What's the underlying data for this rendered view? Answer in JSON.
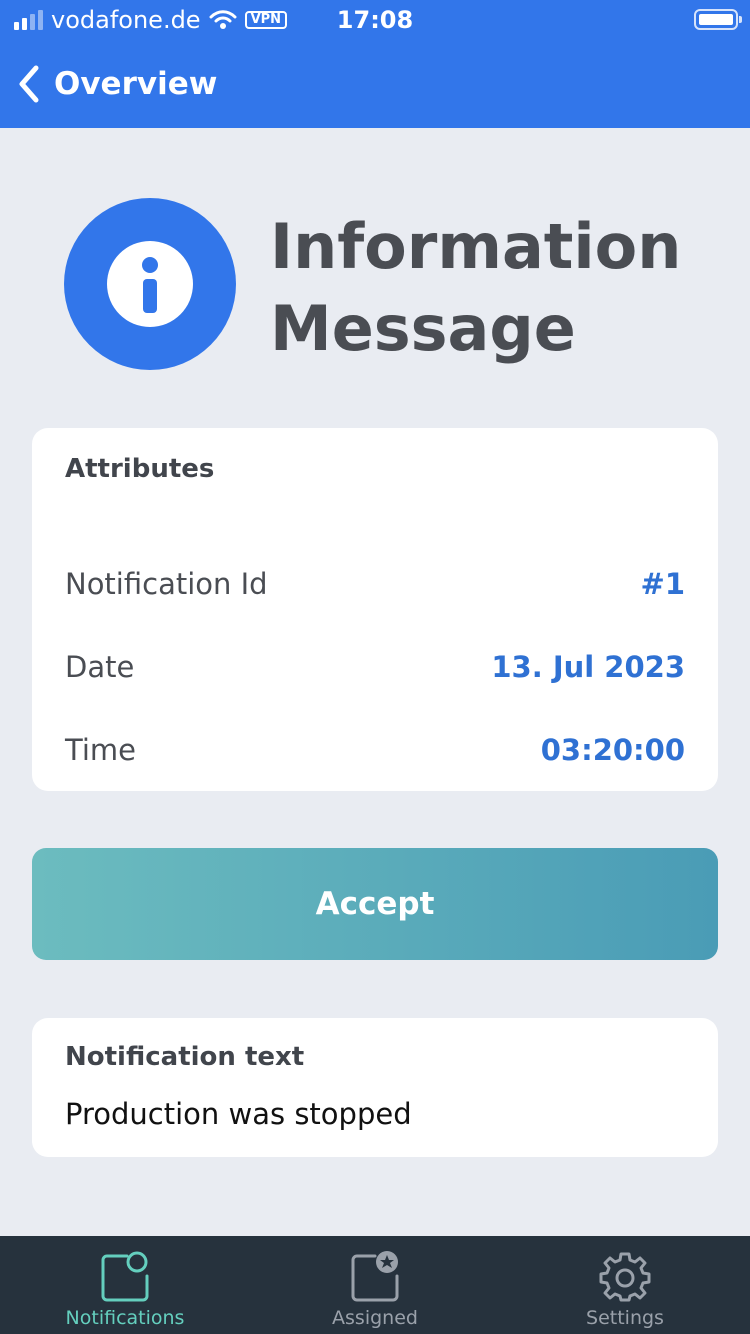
{
  "status_bar": {
    "carrier": "vodafone.de",
    "vpn_label": "VPN",
    "time": "17:08"
  },
  "nav": {
    "back_label": "Overview"
  },
  "hero": {
    "title_line1": "Information",
    "title_line2": "Message",
    "icon": "info-icon"
  },
  "attributes": {
    "title": "Attributes",
    "rows": [
      {
        "label": "Notification Id",
        "value": "#1"
      },
      {
        "label": "Date",
        "value": "13. Jul 2023"
      },
      {
        "label": "Time",
        "value": "03:20:00"
      }
    ]
  },
  "accept_label": "Accept",
  "notification": {
    "title": "Notification text",
    "text": "Production was stopped"
  },
  "tabs": [
    {
      "label": "Notifications",
      "icon": "notifications-icon",
      "active": true
    },
    {
      "label": "Assigned",
      "icon": "assigned-icon",
      "active": false
    },
    {
      "label": "Settings",
      "icon": "gear-icon",
      "active": false
    }
  ],
  "colors": {
    "header": "#3276ea",
    "accent_value": "#2f71d3",
    "accept_start": "#6cbcbf",
    "accept_end": "#4a9cb6",
    "tab_bar": "#26323d",
    "tab_active": "#64cfbe",
    "tab_inactive": "#9aa1aa",
    "background": "#e9ecf2"
  }
}
